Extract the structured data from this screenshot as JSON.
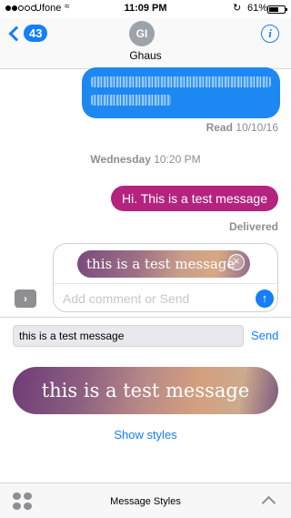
{
  "status_bar": {
    "signal_full": 2,
    "signal_total": 5,
    "carrier": "Ufone",
    "time": "11:09 PM",
    "battery_percent": "61%",
    "battery_level": 0.61
  },
  "nav": {
    "back_count": "43",
    "avatar_initials": "GI",
    "contact_name": "Ghaus",
    "info_symbol": "i"
  },
  "messages": {
    "read_label": "Read",
    "read_date": "10/10/16",
    "day_label": "Wednesday",
    "day_time": "10:20 PM",
    "sent_text": "Hi. This is a test message",
    "delivered_label": "Delivered"
  },
  "compose": {
    "styled_text": "this is a test message",
    "comment_placeholder": "Add comment or Send"
  },
  "app_panel": {
    "input_value": "this is a test message",
    "send_label": "Send",
    "preview_text": "this is a test message",
    "show_styles_label": "Show styles",
    "app_title": "Message Styles"
  },
  "colors": {
    "accent": "#147efb",
    "sent_bubble": "#b4237e",
    "blue_bubble": "#1e88f2"
  },
  "icons": [
    "chevron-left-icon",
    "info-icon",
    "close-icon",
    "arrow-up-icon",
    "chevron-right-icon",
    "app-grid-icon",
    "chevron-up-icon",
    "wifi-icon",
    "rotation-lock-icon",
    "battery-icon"
  ]
}
